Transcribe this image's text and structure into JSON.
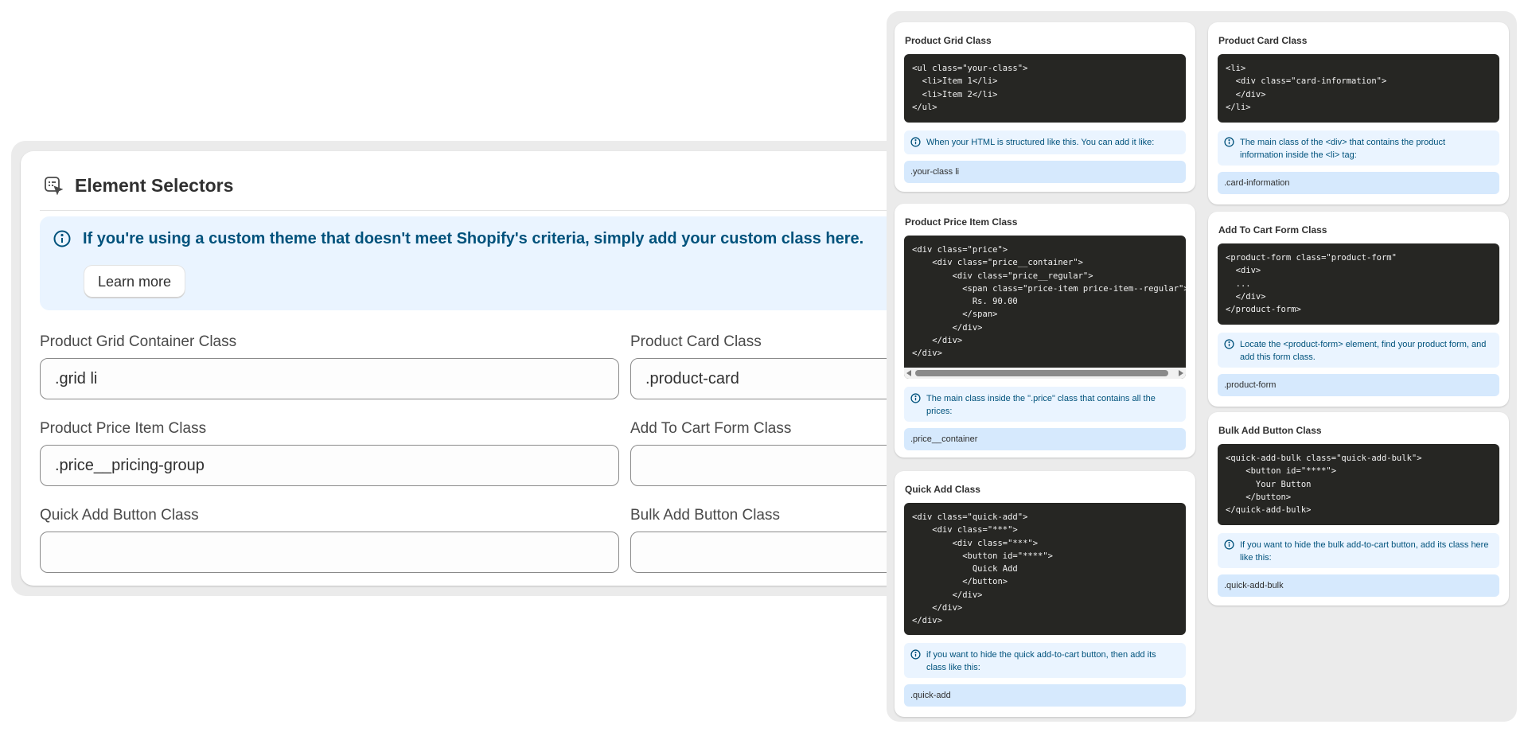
{
  "settings": {
    "title": "Element Selectors",
    "icon": "selector-cursor-icon",
    "banner": {
      "icon": "info-icon",
      "text": "If you're using a custom theme that doesn't meet Shopify's criteria, simply add your custom class here.",
      "learn_more": "Learn more"
    },
    "fields": [
      {
        "label": "Product Grid Container Class",
        "value": ".grid li"
      },
      {
        "label": "Product Card Class",
        "value": ".product-card"
      },
      {
        "label": "Product Price Item Class",
        "value": ".price__pricing-group"
      },
      {
        "label": "Add To Cart Form Class",
        "value": ""
      },
      {
        "label": "Quick Add Button Class",
        "value": ""
      },
      {
        "label": "Bulk Add Button Class",
        "value": ""
      }
    ]
  },
  "help": {
    "product_grid": {
      "title": "Product Grid Class",
      "code": "<ul class=\"your-class\">\n  <li>Item 1</li>\n  <li>Item 2</li>\n</ul>",
      "note": "When your HTML is structured like this. You can add it like:",
      "example": ".your-class li"
    },
    "product_card": {
      "title": "Product Card Class",
      "code": "<li>\n  <div class=\"card-information\">\n  </div>\n</li>",
      "note": "The main class of the <div> that contains the product information inside the <li> tag:",
      "example": ".card-information"
    },
    "price_item": {
      "title": "Product Price Item Class",
      "code": "<div class=\"price\">\n    <div class=\"price__container\">\n        <div class=\"price__regular\">\n          <span class=\"price-item price-item--regular\">\n            Rs. 90.00\n          </span>\n        </div>\n    </div>\n</div>",
      "note": "The main class inside the \".price\" class that contains all the prices:",
      "example": ".price__container"
    },
    "add_to_cart_form": {
      "title": "Add To Cart Form Class",
      "code": "<product-form class=\"product-form\"\n  <div>\n  ...\n  </div>\n</product-form>",
      "note": "Locate the <product-form> element, find your product form, and add this form class.",
      "example": ".product-form"
    },
    "quick_add": {
      "title": "Quick Add Class",
      "code": "<div class=\"quick-add\">\n    <div class=\"***\">\n        <div class=\"***\">\n          <button id=\"****\">\n            Quick Add\n          </button>\n        </div>\n    </div>\n</div>",
      "note": "if you want to hide the quick add-to-cart button, then add its class like this:",
      "example": ".quick-add"
    },
    "bulk_add": {
      "title": "Bulk Add Button Class",
      "code": "<quick-add-bulk class=\"quick-add-bulk\">\n    <button id=\"****\">\n      Your Button\n    </button>\n</quick-add-bulk>",
      "note": "If you want to hide the bulk add-to-cart button, add its class here like this:",
      "example": ".quick-add-bulk"
    }
  }
}
